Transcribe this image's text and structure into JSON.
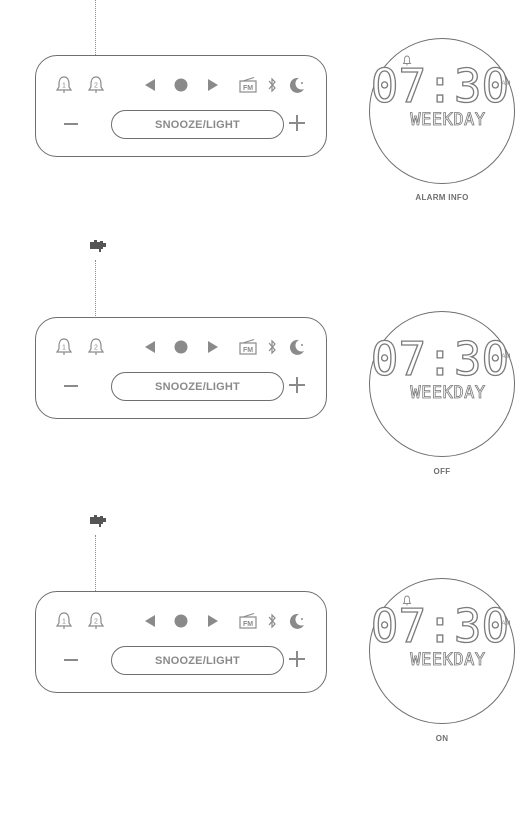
{
  "colors": {
    "line": "#6f6f6f",
    "icon": "#8a8a8a",
    "hand": "#555555"
  },
  "panel": {
    "snooze_label": "SNOOZE/LIGHT",
    "fm_label": "FM",
    "alarm1_num": "1",
    "alarm2_num": "2",
    "icons": [
      "alarm-1-icon",
      "alarm-2-icon",
      "prev-icon",
      "play-icon",
      "next-icon",
      "radio-icon",
      "bluetooth-icon",
      "moon-icon"
    ]
  },
  "display": {
    "time": "07:30",
    "ampm": "AM",
    "weekday": "WEEKDAY"
  },
  "steps": [
    {
      "caption": "ALARM INFO",
      "alarm_icon_visible": true,
      "hand_icon": "pointing-hand-icon"
    },
    {
      "caption": "OFF",
      "alarm_icon_visible": false,
      "hand_icon": "pointing-hand-icon"
    },
    {
      "caption": "ON",
      "alarm_icon_visible": true,
      "hand_icon": "pointing-hand-icon"
    }
  ]
}
